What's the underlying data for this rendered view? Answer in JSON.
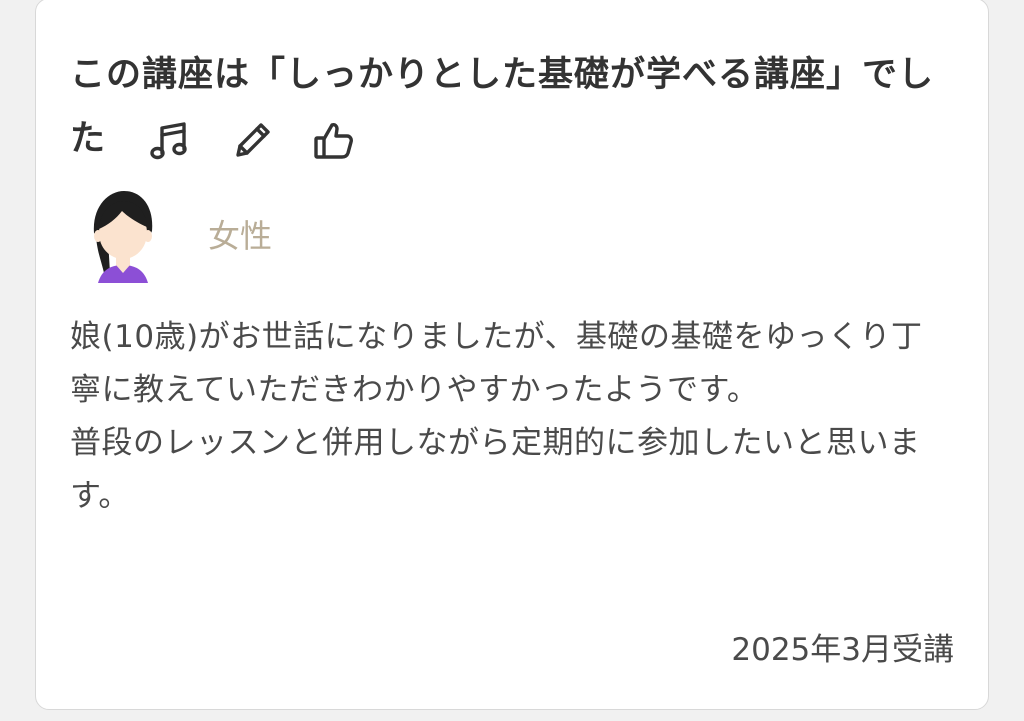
{
  "review": {
    "title": "この講座は「しっかりとした基礎が学べる講座」でした",
    "icons": [
      "music-note-icon",
      "pencil-icon",
      "thumbs-up-icon"
    ],
    "reviewer_gender": "女性",
    "body_paragraph_1": "娘(10歳)がお世話になりましたが、基礎の基礎をゆっくり丁寧に教えていただきわかりやすかったようです。",
    "body_paragraph_2": "普段のレッスンと併用しながら定期的に参加したいと思います。",
    "date": "2025年3月受講"
  },
  "colors": {
    "background": "#f1f1f1",
    "card": "#ffffff",
    "gender_label": "#b9ad97",
    "avatar_shirt": "#8c4fd6",
    "avatar_hair": "#1f1f1f",
    "avatar_skin": "#fbe3cf"
  }
}
